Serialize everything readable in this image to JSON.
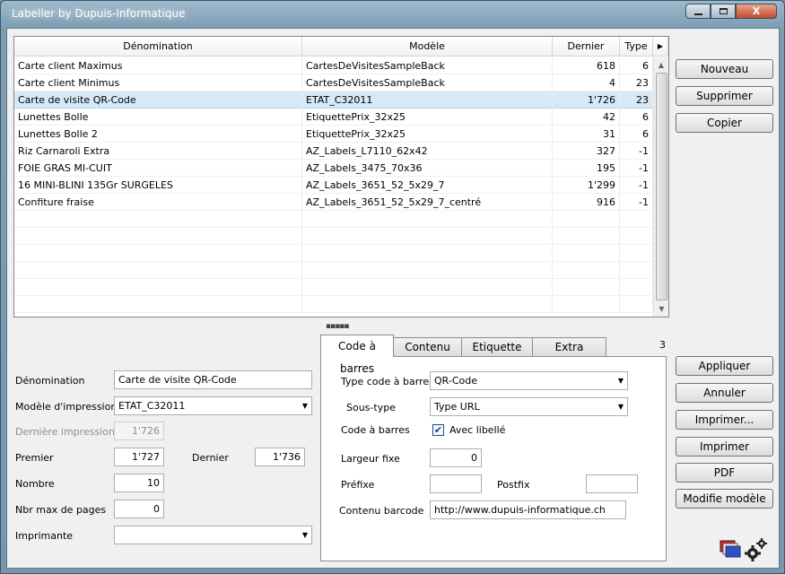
{
  "window": {
    "title": "Labeller by Dupuis-Informatique",
    "min_icon": "minimize-icon",
    "max_icon": "maximize-icon",
    "close_label": "X"
  },
  "grid": {
    "columns": [
      "Dénomination",
      "Modèle",
      "Dernier",
      "Type"
    ],
    "rows": [
      {
        "name": "Carte client Maximus",
        "model": "CartesDeVisitesSampleBack",
        "last": "618",
        "type": "6"
      },
      {
        "name": "Carte client Minimus",
        "model": "CartesDeVisitesSampleBack",
        "last": "4",
        "type": "23"
      },
      {
        "name": "Carte de visite QR-Code",
        "model": "ETAT_C32011",
        "last": "1'726",
        "type": "23"
      },
      {
        "name": "Lunettes Bolle",
        "model": "EtiquettePrix_32x25",
        "last": "42",
        "type": "6"
      },
      {
        "name": "Lunettes Bolle 2",
        "model": "EtiquettePrix_32x25",
        "last": "31",
        "type": "6"
      },
      {
        "name": "Riz Carnaroli Extra",
        "model": "AZ_Labels_L7110_62x42",
        "last": "327",
        "type": "-1"
      },
      {
        "name": "FOIE GRAS MI-CUIT",
        "model": "AZ_Labels_3475_70x36",
        "last": "195",
        "type": "-1"
      },
      {
        "name": "16 MINI-BLINI 135Gr SURGELES",
        "model": "AZ_Labels_3651_52_5x29_7",
        "last": "1'299",
        "type": "-1"
      },
      {
        "name": "Confiture fraise",
        "model": "AZ_Labels_3651_52_5x29_7_centré",
        "last": "916",
        "type": "-1"
      }
    ]
  },
  "side_buttons_top": {
    "new": "Nouveau",
    "delete": "Supprimer",
    "copy": "Copier"
  },
  "side_buttons_bottom": {
    "apply": "Appliquer",
    "cancel": "Annuler",
    "print_dialog": "Imprimer...",
    "print": "Imprimer",
    "pdf": "PDF",
    "edit_model": "Modifie modèle"
  },
  "form": {
    "name_label": "Dénomination",
    "name_value": "Carte de visite QR-Code",
    "model_label": "Modèle d'impression",
    "model_value": "ETAT_C32011",
    "last_print_label": "Dernière impression",
    "last_print_value": "1'726",
    "first_label": "Premier",
    "first_value": "1'727",
    "last_label": "Dernier",
    "last_value": "1'736",
    "count_label": "Nombre",
    "count_value": "10",
    "max_pages_label": "Nbr max de pages",
    "max_pages_value": "0",
    "printer_label": "Imprimante",
    "printer_value": ""
  },
  "tabs": [
    "Code à barres",
    "Contenu",
    "Etiquette",
    "Extra"
  ],
  "tab_count": "3",
  "barcode": {
    "type_label": "Type code à barres",
    "type_value": "QR-Code",
    "subtype_label": "Sous-type",
    "subtype_value": "Type URL",
    "barcode_label": "Code à barres",
    "with_label_text": "Avec libellé",
    "with_label_checked": true,
    "fixed_width_label": "Largeur fixe",
    "fixed_width_value": "0",
    "prefix_label": "Préfixe",
    "prefix_value": "",
    "postfix_label": "Postfix",
    "postfix_value": "",
    "content_label": "Contenu barcode",
    "content_value": "http://www.dupuis-informatique.ch"
  },
  "footer_icons": [
    "labels-icon",
    "settings-gears-icon"
  ]
}
